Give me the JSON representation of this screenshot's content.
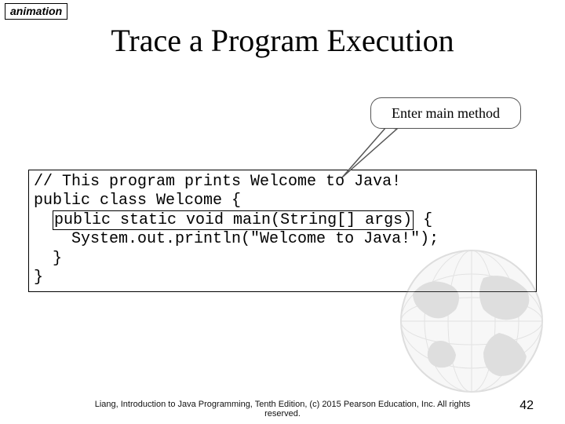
{
  "tag": "animation",
  "title": "Trace a Program Execution",
  "callout": "Enter main method",
  "code": {
    "line1": "// This program prints Welcome to Java!",
    "line2": "public class Welcome {",
    "line3_pre": "  ",
    "line3_hl": "public static void main(String[] args)",
    "line3_post": " {",
    "line4": "    System.out.println(\"Welcome to Java!\");",
    "line5": "  }",
    "line6": "}"
  },
  "footer": "Liang, Introduction to Java Programming, Tenth Edition, (c) 2015 Pearson Education, Inc. All rights reserved.",
  "page": "42"
}
